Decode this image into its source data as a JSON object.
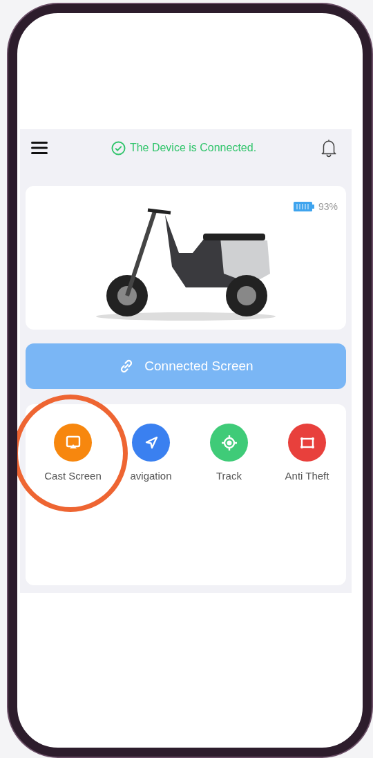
{
  "header": {
    "status": "The Device is Connected."
  },
  "vehicle": {
    "battery": "93%"
  },
  "connect_button": {
    "label": "Connected Screen"
  },
  "actions": [
    {
      "kind": "cast",
      "label": "Cast Screen",
      "color": "#f7870e",
      "highlighted": true
    },
    {
      "kind": "navigation",
      "label": "avigation",
      "color": "#3a80f0",
      "highlighted": false
    },
    {
      "kind": "track",
      "label": "Track",
      "color": "#3fcb78",
      "highlighted": false
    },
    {
      "kind": "antitheft",
      "label": "Anti Theft",
      "color": "#e8403c",
      "highlighted": false
    }
  ]
}
